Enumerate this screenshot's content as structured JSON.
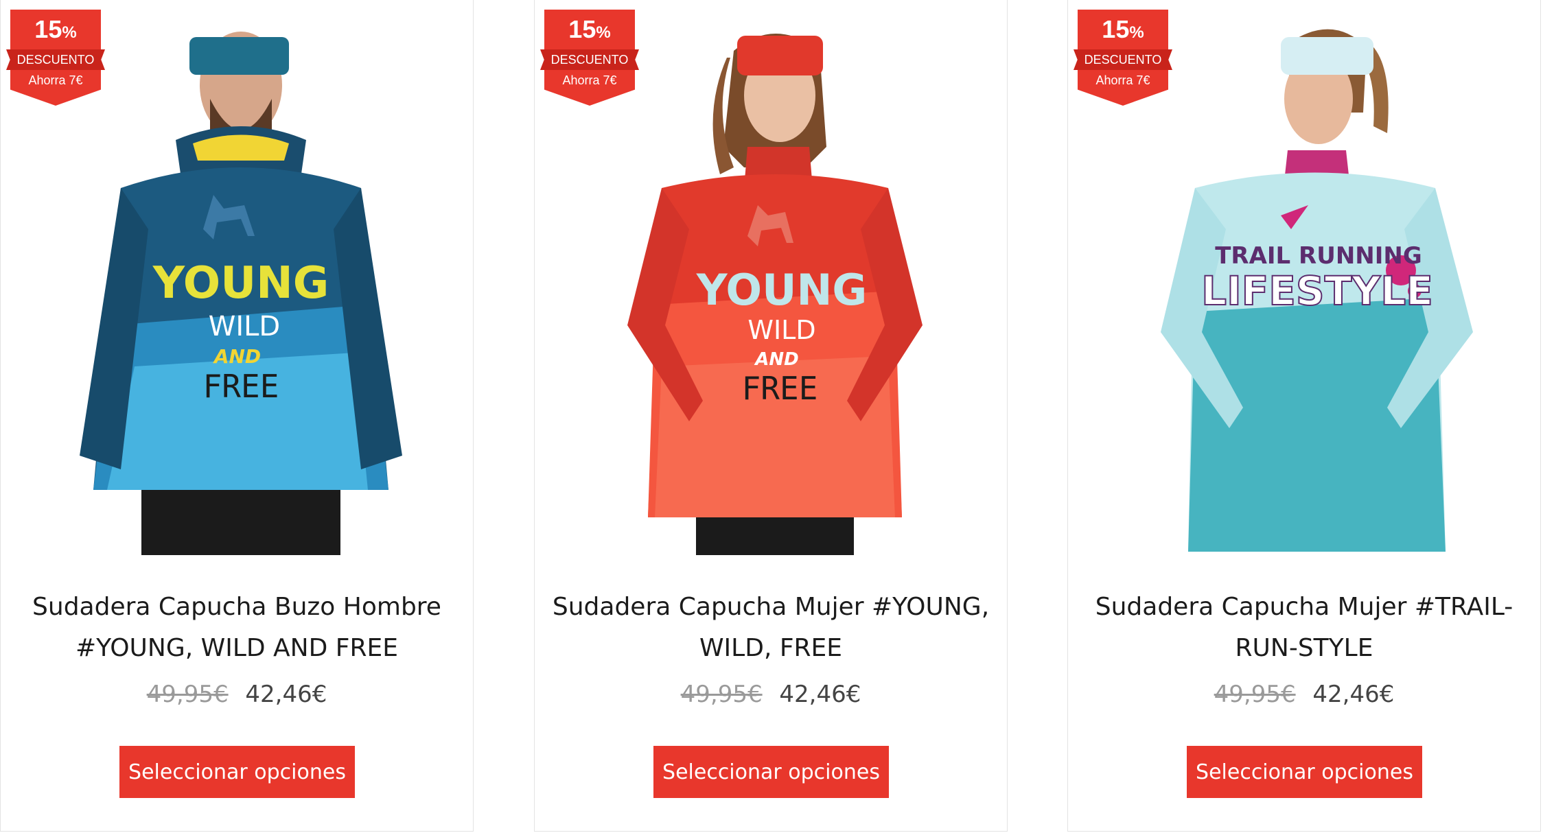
{
  "colors": {
    "accent": "#e8372c",
    "accent_dark": "#c9241b",
    "title_text": "#1b1b1b",
    "old_price": "#9a9a9a",
    "new_price": "#444444"
  },
  "products": [
    {
      "badge": {
        "percent": "15",
        "percent_sign": "%",
        "label": "DESCUENTO",
        "savings": "Ahorra 7€"
      },
      "image_alt": "hoodie-blue-young-wild-free-man",
      "title_line1": "Sudadera Capucha Buzo Hombre",
      "title_line2": "#YOUNG, WILD AND FREE",
      "old_price": "49,95€",
      "new_price": "42,46€",
      "button_label": "Seleccionar opciones",
      "print": {
        "line1": "YOUNG",
        "line2": "WILD",
        "line3": "AND",
        "line4": "FREE"
      }
    },
    {
      "badge": {
        "percent": "15",
        "percent_sign": "%",
        "label": "DESCUENTO",
        "savings": "Ahorra 7€"
      },
      "image_alt": "hoodie-red-young-wild-free-woman",
      "title_line1": "Sudadera Capucha Mujer #YOUNG,",
      "title_line2": "WILD, FREE",
      "old_price": "49,95€",
      "new_price": "42,46€",
      "button_label": "Seleccionar opciones",
      "print": {
        "line1": "YOUNG",
        "line2": "WILD",
        "line3": "AND",
        "line4": "FREE"
      }
    },
    {
      "badge": {
        "percent": "15",
        "percent_sign": "%",
        "label": "DESCUENTO",
        "savings": "Ahorra 7€"
      },
      "image_alt": "hoodie-turquoise-trail-running-lifestyle-woman",
      "title_line1": "Sudadera Capucha Mujer #TRAIL-",
      "title_line2": "RUN-STYLE",
      "old_price": "49,95€",
      "new_price": "42,46€",
      "button_label": "Seleccionar opciones",
      "print": {
        "line1": "TRAIL RUNNING",
        "line2": "LIFESTYLE"
      }
    }
  ]
}
